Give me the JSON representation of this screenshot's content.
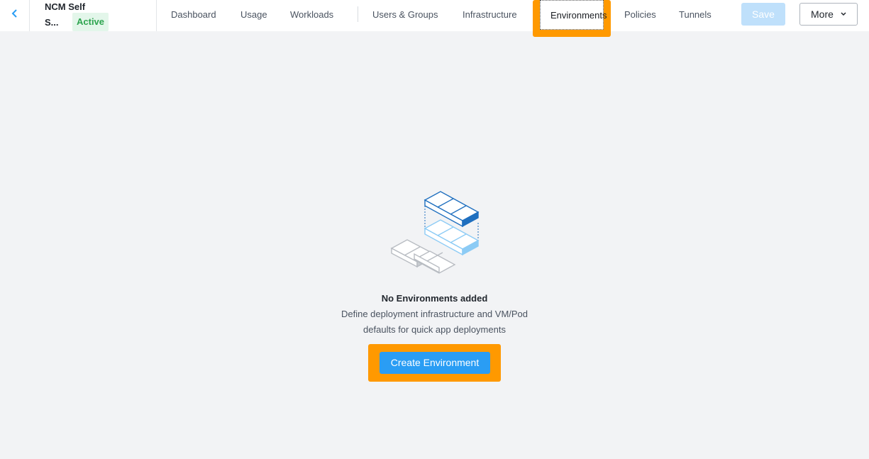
{
  "header": {
    "project_name_line1": "NCM Self",
    "project_name_line2": "S...",
    "status": "Active",
    "tabs": [
      {
        "label": "Dashboard"
      },
      {
        "label": "Usage"
      },
      {
        "label": "Workloads"
      },
      {
        "label": "Users & Groups"
      },
      {
        "label": "Infrastructure"
      },
      {
        "label": "Environments",
        "active": true
      },
      {
        "label": "Policies"
      },
      {
        "label": "Tunnels"
      }
    ],
    "save_label": "Save",
    "more_label": "More"
  },
  "empty_state": {
    "title": "No Environments added",
    "description_line1": "Define deployment infrastructure and VM/Pod",
    "description_line2": "defaults for quick app deployments",
    "button_label": "Create Environment"
  },
  "colors": {
    "accent": "#2a9df4",
    "highlight": "#ff9900",
    "status_green": "#2ea44f",
    "background": "#f2f3f5"
  }
}
